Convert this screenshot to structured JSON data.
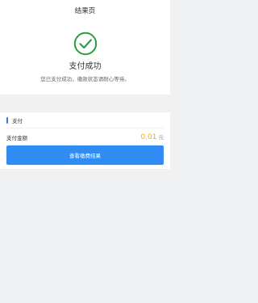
{
  "header": {
    "title": "结果页"
  },
  "result": {
    "icon": "check-circle-icon",
    "title": "支付成功",
    "description": "您已支付成功，缴款状态请耐心等待。"
  },
  "payment": {
    "section_label": "支付",
    "amount_label": "支付金额",
    "amount_value": "0.01",
    "amount_unit": "元"
  },
  "actions": {
    "view_result_label": "查看缴费结果"
  },
  "colors": {
    "success_green": "#2a9d3c",
    "accent_blue": "#2b7bdb",
    "button_blue": "#2f8cf3",
    "amount_orange": "#f5a623"
  }
}
